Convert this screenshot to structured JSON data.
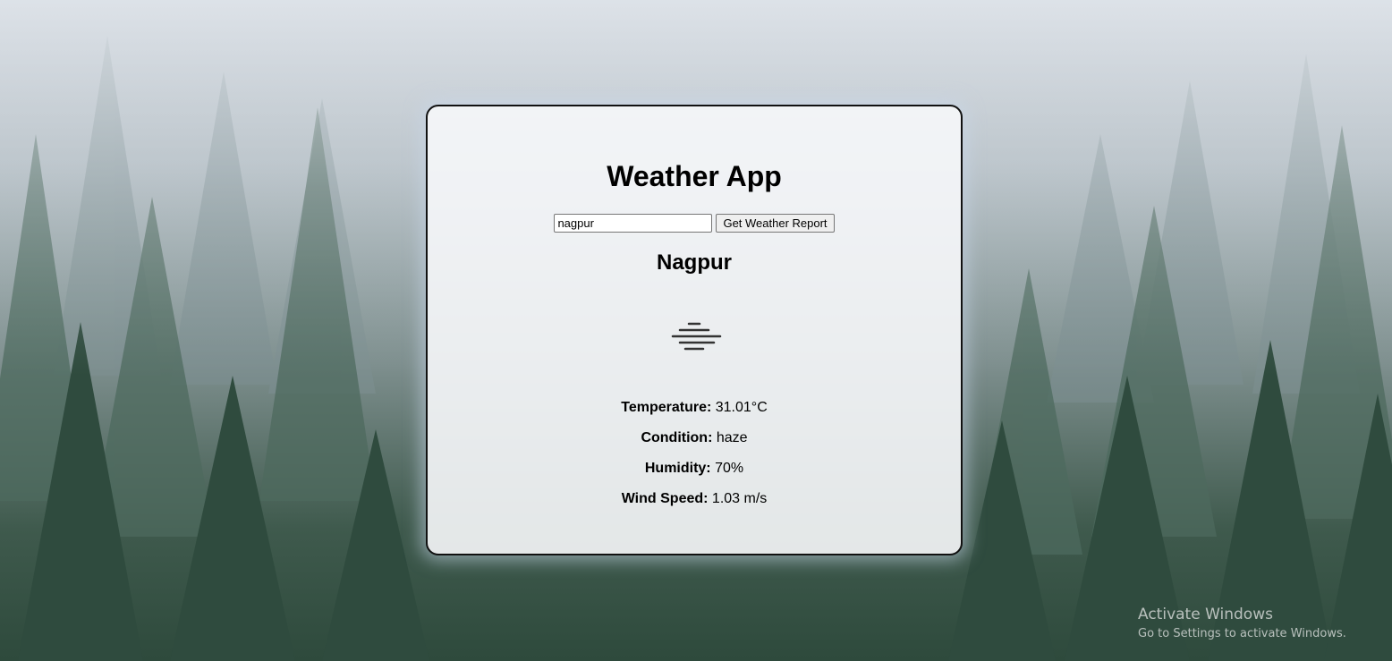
{
  "app": {
    "title": "Weather App"
  },
  "search": {
    "value": "nagpur",
    "button_label": "Get Weather Report"
  },
  "weather": {
    "city": "Nagpur",
    "icon": "haze-icon",
    "temperature_label": "Temperature:",
    "temperature_value": "31.01°C",
    "condition_label": "Condition:",
    "condition_value": "haze",
    "humidity_label": "Humidity:",
    "humidity_value": "70%",
    "wind_label": "Wind Speed:",
    "wind_value": "1.03 m/s"
  },
  "watermark": {
    "title": "Activate Windows",
    "subtitle": "Go to Settings to activate Windows."
  }
}
